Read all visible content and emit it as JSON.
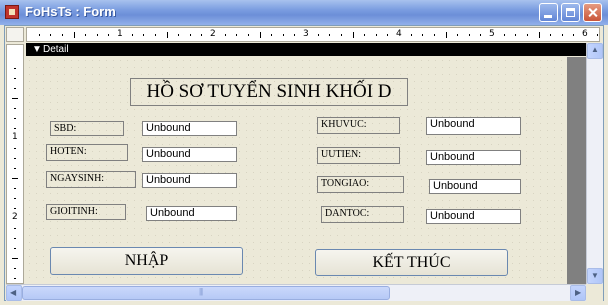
{
  "window": {
    "title": "FoHsTs : Form",
    "icon": "access-form-icon"
  },
  "ruler": {
    "horizontal_numbers": [
      "1",
      "2",
      "3",
      "4",
      "5",
      "6"
    ],
    "vertical_numbers": [
      "1",
      "2"
    ]
  },
  "section": {
    "label": "Detail"
  },
  "form": {
    "heading": "HỒ SƠ TUYỂN SINH KHỐI D",
    "fields": [
      {
        "label": "SBD:",
        "value": "Unbound"
      },
      {
        "label": "HOTEN:",
        "value": "Unbound"
      },
      {
        "label": "NGAYSINH:",
        "value": "Unbound"
      },
      {
        "label": "GIOITINH:",
        "value": "Unbound"
      },
      {
        "label": "KHUVUC:",
        "value": "Unbound"
      },
      {
        "label": "UUTIEN:",
        "value": "Unbound"
      },
      {
        "label": "TONGIAO:",
        "value": "Unbound"
      },
      {
        "label": "DANTOC:",
        "value": "Unbound"
      }
    ],
    "buttons": {
      "submit": "NHẬP",
      "exit": "KẾT THÚC"
    }
  }
}
